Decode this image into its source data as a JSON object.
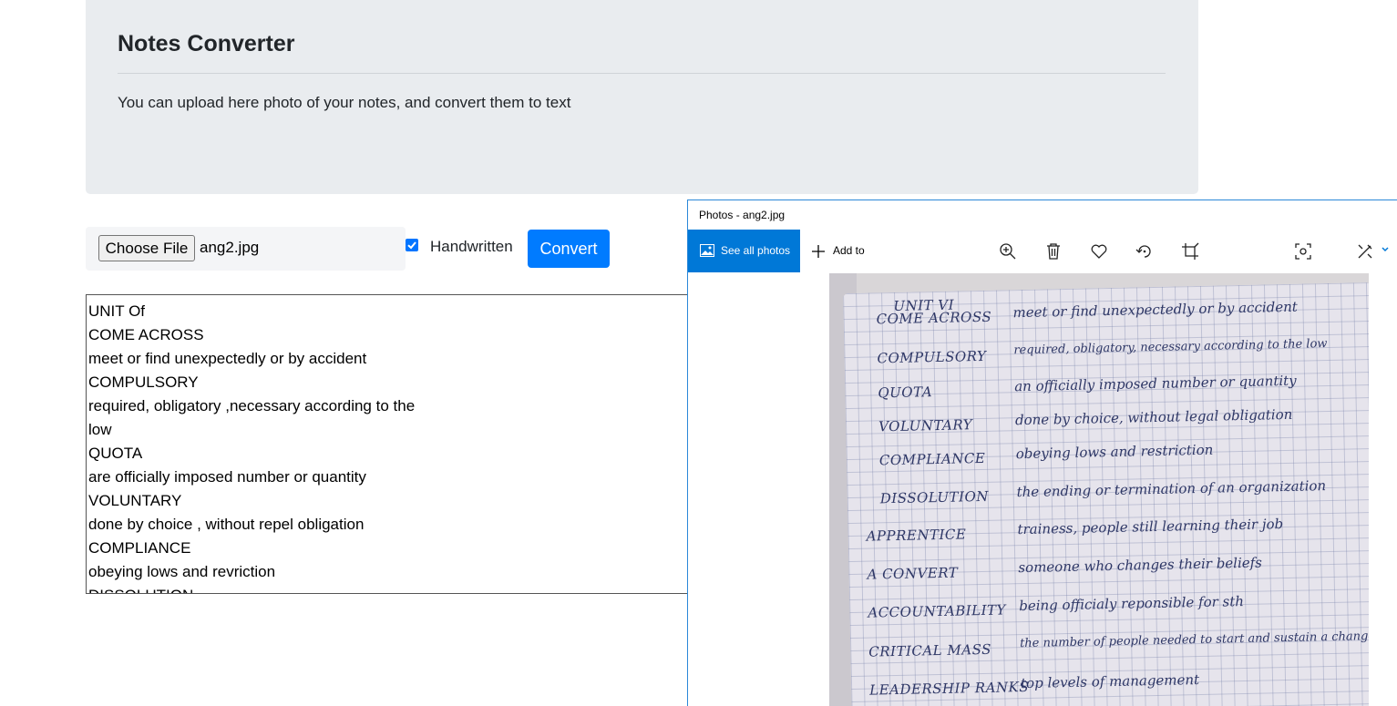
{
  "header": {
    "title": "Notes Converter",
    "lead": "You can upload here photo of your notes, and convert them to text"
  },
  "form": {
    "choose_file_label": "Choose File",
    "file_name": "ang2.jpg",
    "handwritten_label": "Handwritten",
    "handwritten_checked": true,
    "convert_label": "Convert"
  },
  "output": {
    "lines": [
      "UNIT Of",
      "COME ACROSS",
      "meet or find unexpectedly or by accident",
      "COMPULSORY",
      "required, obligatory ,necessary according to the",
      "low",
      "QUOTA",
      "are officially imposed number or quantity",
      "VOLUNTARY",
      "done by choice , without repel obligation",
      "COMPLIANCE",
      "obeying lows and revriction",
      "DISSOLUTION"
    ]
  },
  "photos_window": {
    "title": "Photos - ang2.jpg",
    "see_all_label": "See all photos",
    "add_to_label": "Add to",
    "toolbar_icons": [
      "zoom-in-icon",
      "delete-icon",
      "heart-icon",
      "rotate-icon",
      "crop-icon",
      "visual-search-icon",
      "edit-icon"
    ],
    "accent": "#0078d7",
    "notes": {
      "heading": "UNIT VI",
      "entries": [
        {
          "term": "COME ACROSS",
          "meaning": "meet or find unexpectedly or by accident"
        },
        {
          "term": "COMPULSORY",
          "meaning": "required, obligatory, necessary according to the low"
        },
        {
          "term": "QUOTA",
          "meaning": "an officially imposed number or quantity"
        },
        {
          "term": "VOLUNTARY",
          "meaning": "done by choice, without legal obligation"
        },
        {
          "term": "COMPLIANCE",
          "meaning": "obeying lows and restriction"
        },
        {
          "term": "DISSOLUTION",
          "meaning": "the ending or termination of an organization"
        },
        {
          "term": "APPRENTICE",
          "meaning": "trainess, people still learning their job"
        },
        {
          "term": "A CONVERT",
          "meaning": "someone who changes their beliefs"
        },
        {
          "term": "ACCOUNTABILITY",
          "meaning": "being officialy reponsible for sth"
        },
        {
          "term": "CRITICAL MASS",
          "meaning": "the number of people needed to start and sustain a change"
        },
        {
          "term": "LEADERSHIP RANKS",
          "meaning": "top levels of management"
        }
      ]
    }
  }
}
